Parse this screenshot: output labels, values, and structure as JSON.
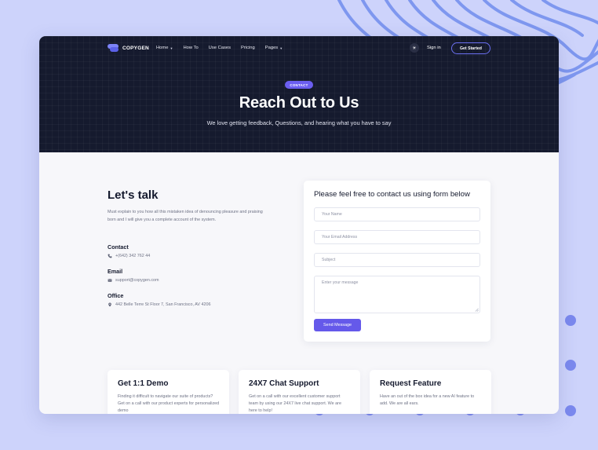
{
  "brand": {
    "name": "COPYGEN"
  },
  "nav": {
    "items": [
      {
        "label": "Home",
        "has_dropdown": true
      },
      {
        "label": "How To",
        "has_dropdown": false
      },
      {
        "label": "Use Cases",
        "has_dropdown": false
      },
      {
        "label": "Pricing",
        "has_dropdown": false
      },
      {
        "label": "Pages",
        "has_dropdown": true
      }
    ],
    "theme_toggle_icon": "sun-icon",
    "signin_label": "Sign in",
    "cta_label": "Get Started"
  },
  "hero": {
    "badge": "CONTACT",
    "title": "Reach Out to Us",
    "subtitle": "We love getting feedback, Questions, and hearing what you have to say"
  },
  "talk": {
    "title": "Let's talk",
    "description": "Must explain to you how all this mistaken idea of denouncing pleasure and praising born and I will give you a complete account of the system.",
    "contact": {
      "label": "Contact",
      "value": "+(642) 342 762 44",
      "icon": "phone-icon"
    },
    "email": {
      "label": "Email",
      "value": "support@copygen.com",
      "icon": "mail-icon"
    },
    "office": {
      "label": "Office",
      "value": "442 Belle Terre St Floor 7, San Francisco, AV 4206",
      "icon": "location-pin-icon"
    }
  },
  "form": {
    "title": "Please feel free to contact us using form below",
    "name_placeholder": "Your Name",
    "email_placeholder": "Your Email Address",
    "subject_placeholder": "Subject",
    "message_placeholder": "Enter your message",
    "submit_label": "Send Message"
  },
  "features": [
    {
      "title": "Get 1:1 Demo",
      "description": "Finding it difficult to navigate our suite of products? Get on a call with our product experts for personalized demo"
    },
    {
      "title": "24X7 Chat Support",
      "description": "Get on a call with our excellent customer support team by using our 24X7 live chat support. We are here to help!"
    },
    {
      "title": "Request Feature",
      "description": "Have an out of the box idea for a new AI feature to add. We are all ears."
    }
  ],
  "colors": {
    "background": "#cdd3fb",
    "hero": "#151a2e",
    "accent": "#6559ea",
    "decoration": "#7f96ee"
  }
}
